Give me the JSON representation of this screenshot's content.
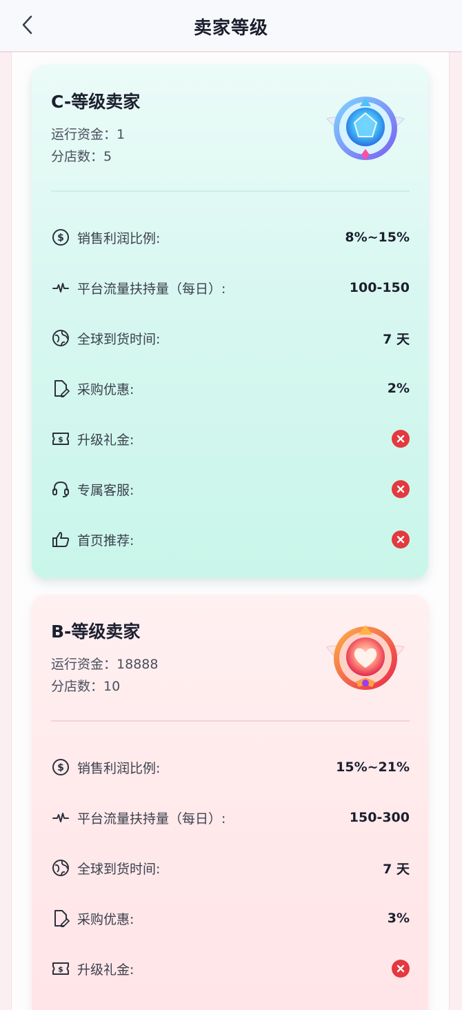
{
  "header": {
    "title": "卖家等级"
  },
  "levels": [
    {
      "title": "C-等级卖家",
      "funds_label": "运行资金：",
      "funds_value": "1",
      "branches_label": "分店数：",
      "branches_value": "5",
      "badge_icon": "blue-diamond-medal-icon",
      "rows": [
        {
          "icon": "dollar-circle-icon",
          "label": "销售利润比例:",
          "value": "8%~15%"
        },
        {
          "icon": "pulse-icon",
          "label": "平台流量扶持量（每日）:",
          "value": "100-150"
        },
        {
          "icon": "globe-icon",
          "label": "全球到货时间:",
          "value": "7 天"
        },
        {
          "icon": "document-edit-icon",
          "label": "采购优惠:",
          "value": "2%"
        },
        {
          "icon": "ticket-icon",
          "label": "升级礼金:",
          "value": null,
          "status": "unavailable"
        },
        {
          "icon": "headset-icon",
          "label": "专属客服:",
          "value": null,
          "status": "unavailable"
        },
        {
          "icon": "thumbs-up-icon",
          "label": "首页推荐:",
          "value": null,
          "status": "unavailable"
        }
      ]
    },
    {
      "title": "B-等级卖家",
      "funds_label": "运行资金：",
      "funds_value": "18888",
      "branches_label": "分店数：",
      "branches_value": "10",
      "badge_icon": "pink-heart-medal-icon",
      "rows": [
        {
          "icon": "dollar-circle-icon",
          "label": "销售利润比例:",
          "value": "15%~21%"
        },
        {
          "icon": "pulse-icon",
          "label": "平台流量扶持量（每日）:",
          "value": "150-300"
        },
        {
          "icon": "globe-icon",
          "label": "全球到货时间:",
          "value": "7 天"
        },
        {
          "icon": "document-edit-icon",
          "label": "采购优惠:",
          "value": "3%"
        },
        {
          "icon": "ticket-icon",
          "label": "升级礼金:",
          "value": null,
          "status": "unavailable"
        }
      ]
    }
  ],
  "colors": {
    "cancel_red": "#e23a3f",
    "c_card_bg": "#d8f7f0",
    "b_card_bg": "#ffe9eb"
  }
}
